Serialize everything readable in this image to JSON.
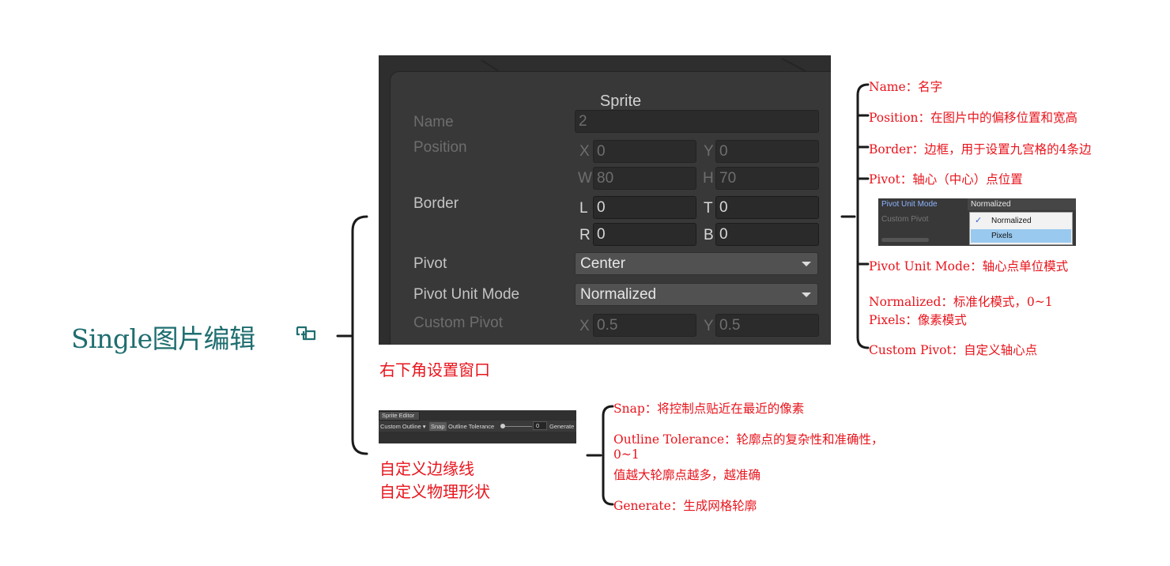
{
  "root": {
    "title": "Single图片编辑",
    "icon": "link-icon"
  },
  "panel": {
    "title": "Sprite",
    "name_label": "Name",
    "name_value": "2",
    "position_label": "Position",
    "pos_x_axis": "X",
    "pos_x": "0",
    "pos_y_axis": "Y",
    "pos_y": "0",
    "pos_w_axis": "W",
    "pos_w": "80",
    "pos_h_axis": "H",
    "pos_h": "70",
    "border_label": "Border",
    "border_l_axis": "L",
    "border_l": "0",
    "border_t_axis": "T",
    "border_t": "0",
    "border_r_axis": "R",
    "border_r": "0",
    "border_b_axis": "B",
    "border_b": "0",
    "pivot_label": "Pivot",
    "pivot_value": "Center",
    "pivot_unit_label": "Pivot Unit Mode",
    "pivot_unit_value": "Normalized",
    "custom_pivot_label": "Custom Pivot",
    "cp_x_axis": "X",
    "cp_x": "0.5",
    "cp_y_axis": "Y",
    "cp_y": "0.5"
  },
  "branch1_label": "右下角设置窗口",
  "branch2_label_line1": "自定义边缘线",
  "branch2_label_line2": "自定义物理形状",
  "notes1": [
    "Name：名字",
    "Position：在图片中的偏移位置和宽高",
    "Border：边框，用于设置九宫格的4条边",
    "Pivot：轴心（中心）点位置",
    "Pivot Unit Mode：轴心点单位模式",
    "Normalized：标准化模式，0~1",
    "Pixels：像素模式",
    "Custom Pivot：自定义轴心点"
  ],
  "mini_pivot": {
    "label": "Pivot Unit Mode",
    "value": "Normalized",
    "custom_label": "Custom Pivot",
    "option1": "Normalized",
    "option2": "Pixels",
    "check": "✓"
  },
  "toolbar": {
    "tab": "Sprite Editor",
    "mode": "Custom Outline",
    "snap": "Snap",
    "tolerance_label": "Outline Tolerance",
    "tolerance_value": "0",
    "generate": "Generate"
  },
  "notes2": [
    "Snap：将控制点贴近在最近的像素",
    "Outline Tolerance：轮廓点的复杂性和准确性，",
    "0~1",
    "值越大轮廓点越多，越准确",
    "Generate：生成网格轮廓"
  ],
  "colors": {
    "note_red": "#e8141c",
    "root_teal": "#1f6e70",
    "line": "#1a1a1a"
  }
}
